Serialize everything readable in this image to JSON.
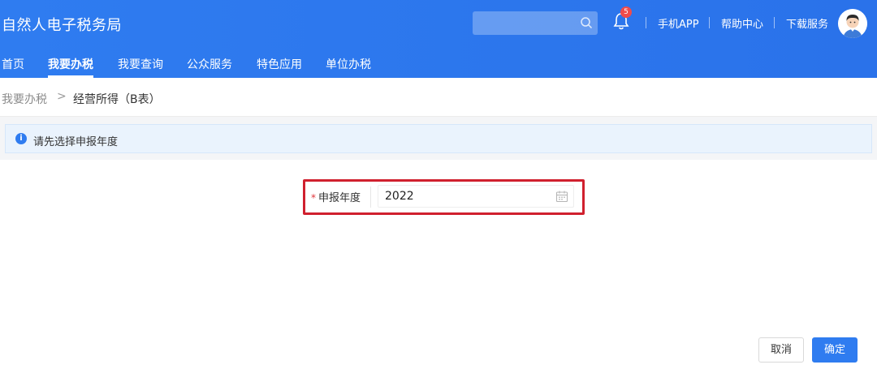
{
  "header": {
    "title": "自然人电子税务局",
    "search_placeholder": "",
    "notification_count": "5",
    "links": [
      "手机APP",
      "帮助中心",
      "下载服务"
    ]
  },
  "nav": {
    "items": [
      "首页",
      "我要办税",
      "我要查询",
      "公众服务",
      "特色应用",
      "单位办税"
    ],
    "active": "我要办税"
  },
  "breadcrumb": {
    "parent": "我要办税",
    "separator": ">",
    "current": "经营所得（B表）"
  },
  "notice": {
    "icon": "info-icon",
    "text": "请先选择申报年度"
  },
  "form": {
    "required_mark": "*",
    "year_label": "申报年度",
    "year_value": "2022"
  },
  "actions": {
    "cancel_label": "取消",
    "confirm_label": "确定"
  },
  "colors": {
    "header_blue": "#2f7cf0",
    "highlight_red": "#d0202e",
    "badge_red": "#f04b4b"
  }
}
